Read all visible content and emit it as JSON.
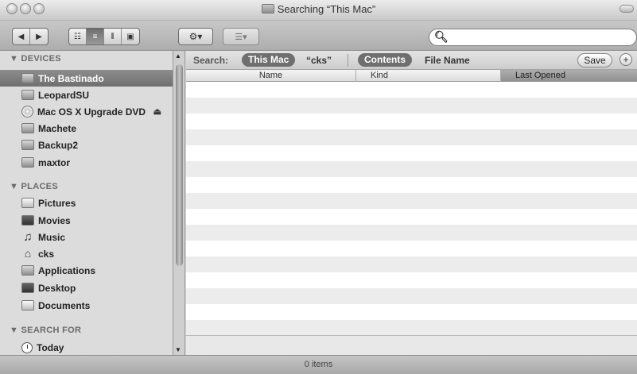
{
  "window": {
    "title": "Searching “This Mac”"
  },
  "toolbar": {
    "back": "◀",
    "forward": "▶",
    "view_icons": "☷",
    "view_list": "≡",
    "view_columns": "⫴",
    "view_coverflow": "▣",
    "action": "⚙▾",
    "arrange": "☰▾",
    "search_value": "",
    "search_icon": "search-icon"
  },
  "sidebar": {
    "devices_header": "▼ DEVICES",
    "devices": [
      {
        "label": "The Bastinado",
        "icon": "hard-drive-icon"
      },
      {
        "label": "LeopardSU",
        "icon": "hard-drive-icon"
      },
      {
        "label": "Mac OS X Upgrade DVD",
        "icon": "dvd-icon",
        "eject": "⏏"
      },
      {
        "label": "Machete",
        "icon": "hard-drive-icon"
      },
      {
        "label": "Backup2",
        "icon": "hard-drive-icon"
      },
      {
        "label": "maxtor",
        "icon": "hard-drive-icon"
      }
    ],
    "places_header": "▼ PLACES",
    "places": [
      {
        "label": "Pictures",
        "icon": "pictures-folder-icon"
      },
      {
        "label": "Movies",
        "icon": "movies-folder-icon"
      },
      {
        "label": "Music",
        "icon": "music-icon",
        "glyph": "♫"
      },
      {
        "label": "cks",
        "icon": "home-icon",
        "glyph": "⌂"
      },
      {
        "label": "Applications",
        "icon": "applications-folder-icon"
      },
      {
        "label": "Desktop",
        "icon": "desktop-icon"
      },
      {
        "label": "Documents",
        "icon": "documents-icon"
      }
    ],
    "search_header": "▼ SEARCH FOR",
    "search_for": [
      {
        "label": "Today",
        "icon": "clock-icon"
      }
    ]
  },
  "searchbar": {
    "label": "Search:",
    "scope_this_mac": "This Mac",
    "scope_folder": "“cks”",
    "contents": "Contents",
    "file_name": "File Name",
    "save": "Save",
    "add": "+"
  },
  "columns": {
    "name": "Name",
    "kind": "Kind",
    "last_opened": "Last Opened"
  },
  "status": {
    "text": "0 items"
  }
}
